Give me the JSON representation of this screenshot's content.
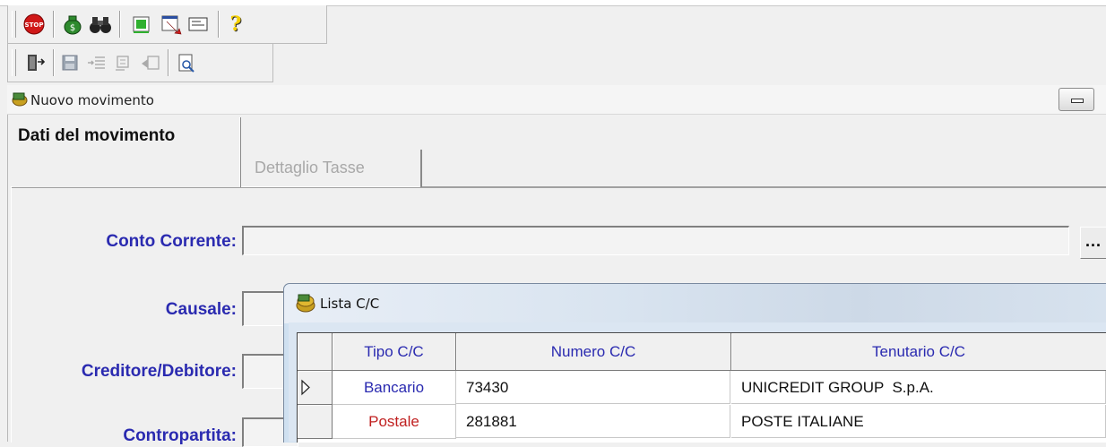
{
  "toolbar1": {
    "buttons": [
      {
        "icon": "stop-icon"
      },
      {
        "icon": "money-bag-icon"
      },
      {
        "icon": "binoculars-icon"
      },
      {
        "icon": "green-export-icon"
      },
      {
        "icon": "red-arrow-icon"
      },
      {
        "icon": "form-icon"
      },
      {
        "icon": "help-icon"
      }
    ]
  },
  "toolbar2": {
    "buttons": [
      {
        "icon": "exit-door-icon"
      },
      {
        "icon": "save-icon"
      },
      {
        "icon": "insert-row-icon"
      },
      {
        "icon": "delete-row-icon"
      },
      {
        "icon": "undo-row-icon"
      },
      {
        "icon": "search-document-icon"
      }
    ]
  },
  "window": {
    "title": "Nuovo movimento",
    "tabs": [
      {
        "label": "Dati del movimento",
        "active": true
      },
      {
        "label": "Dettaglio Tasse",
        "active": false
      }
    ]
  },
  "form": {
    "conto_corrente_label": "Conto Corrente:",
    "conto_corrente_value": "",
    "causale_label": "Causale:",
    "causale_value": "",
    "creditore_label": "Creditore/Debitore:",
    "creditore_value": "",
    "contropartita_label": "Contropartita:",
    "contropartita_value": "",
    "lookup_button": "..."
  },
  "lista": {
    "title": "Lista C/C",
    "columns": [
      "Tipo C/C",
      "Numero C/C",
      "Tenutario C/C"
    ],
    "rows": [
      {
        "tipo": "Bancario",
        "numero": "73430",
        "tenutario": "UNICREDIT GROUP  S.p.A.",
        "selected": true
      },
      {
        "tipo": "Postale",
        "numero": "281881",
        "tenutario": "POSTE ITALIANE",
        "selected": false
      }
    ]
  },
  "colors": {
    "label_blue": "#2a2ab0",
    "bancario_blue": "#2a2ab0",
    "postale_red": "#c02020"
  }
}
